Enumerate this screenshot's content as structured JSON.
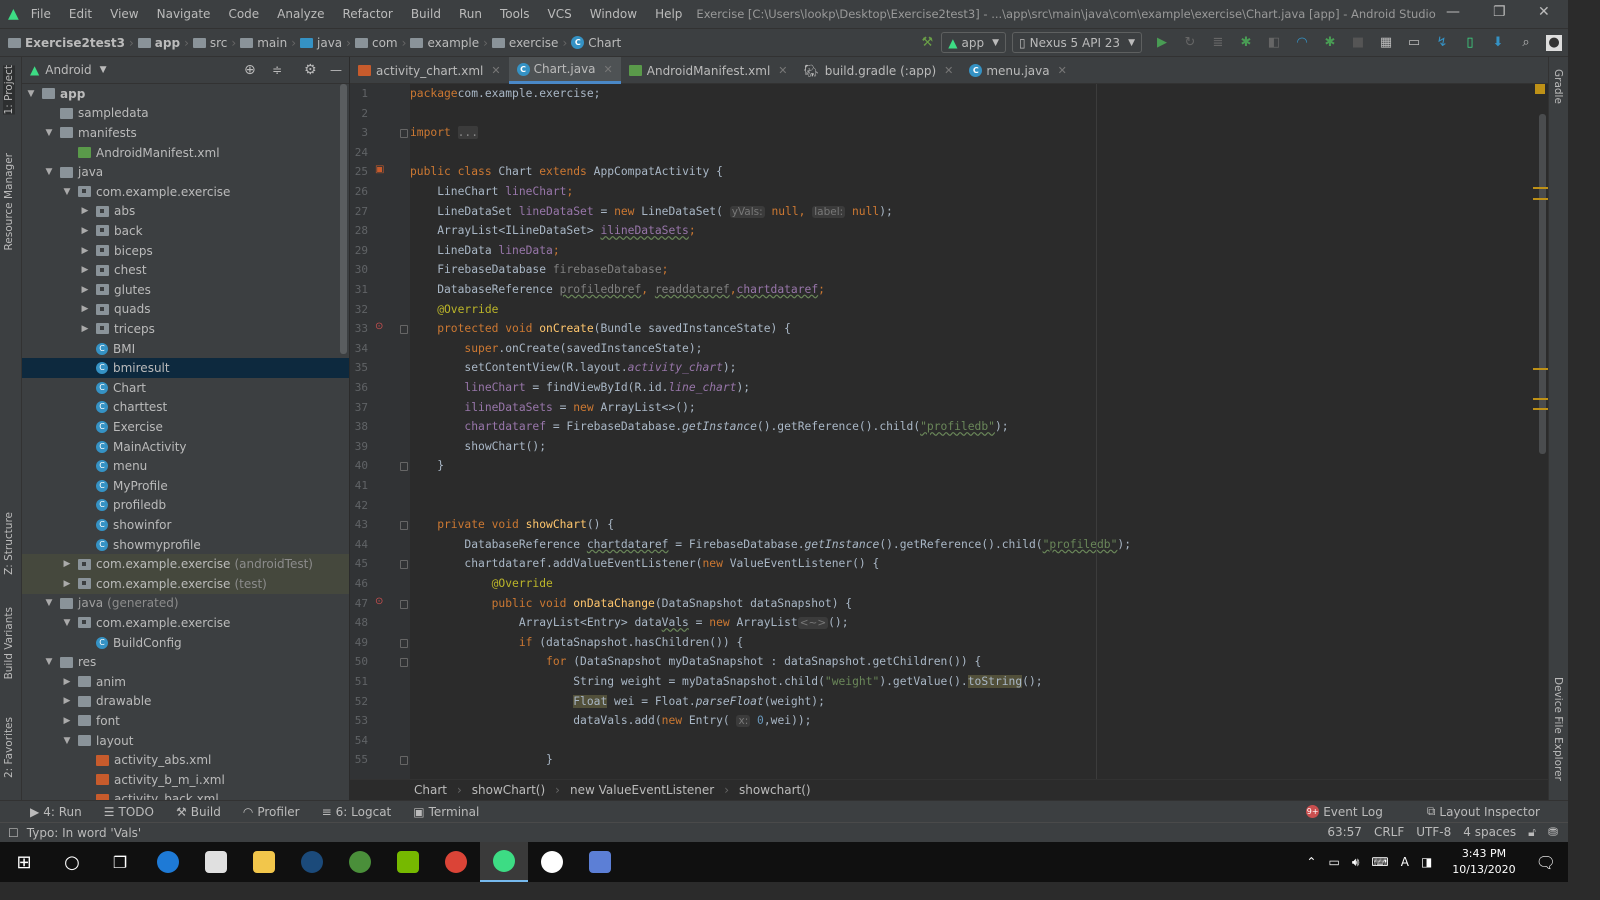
{
  "window": {
    "title": "Exercise [C:\\Users\\lookp\\Desktop\\Exercise2test3] - ...\\app\\src\\main\\java\\com\\example\\exercise\\Chart.java [app] - Android Studio",
    "menu": [
      "File",
      "Edit",
      "View",
      "Navigate",
      "Code",
      "Analyze",
      "Refactor",
      "Build",
      "Run",
      "Tools",
      "VCS",
      "Window",
      "Help"
    ]
  },
  "navbar": {
    "crumbs": [
      "Exercise2test3",
      "app",
      "src",
      "main",
      "java",
      "com",
      "example",
      "exercise",
      "Chart"
    ],
    "run_config": "app",
    "device": "Nexus 5 API 23"
  },
  "project": {
    "view_label": "Android",
    "tree": [
      {
        "label": "app",
        "level": 0,
        "arrow": "open",
        "icon": "folder",
        "bold": true
      },
      {
        "label": "sampledata",
        "level": 1,
        "arrow": "none",
        "icon": "folder"
      },
      {
        "label": "manifests",
        "level": 1,
        "arrow": "open",
        "icon": "folder"
      },
      {
        "label": "AndroidManifest.xml",
        "level": 2,
        "arrow": "none",
        "icon": "mf"
      },
      {
        "label": "java",
        "level": 1,
        "arrow": "open",
        "icon": "folder"
      },
      {
        "label": "com.example.exercise",
        "level": 2,
        "arrow": "open",
        "icon": "pkg"
      },
      {
        "label": "abs",
        "level": 3,
        "arrow": "closed",
        "icon": "pkg"
      },
      {
        "label": "back",
        "level": 3,
        "arrow": "closed",
        "icon": "pkg"
      },
      {
        "label": "biceps",
        "level": 3,
        "arrow": "closed",
        "icon": "pkg"
      },
      {
        "label": "chest",
        "level": 3,
        "arrow": "closed",
        "icon": "pkg"
      },
      {
        "label": "glutes",
        "level": 3,
        "arrow": "closed",
        "icon": "pkg"
      },
      {
        "label": "quads",
        "level": 3,
        "arrow": "closed",
        "icon": "pkg"
      },
      {
        "label": "triceps",
        "level": 3,
        "arrow": "closed",
        "icon": "pkg"
      },
      {
        "label": "BMI",
        "level": 3,
        "arrow": "none",
        "icon": "class"
      },
      {
        "label": "bmiresult",
        "level": 3,
        "arrow": "none",
        "icon": "class",
        "state": "selected"
      },
      {
        "label": "Chart",
        "level": 3,
        "arrow": "none",
        "icon": "class"
      },
      {
        "label": "charttest",
        "level": 3,
        "arrow": "none",
        "icon": "class"
      },
      {
        "label": "Exercise",
        "level": 3,
        "arrow": "none",
        "icon": "class"
      },
      {
        "label": "MainActivity",
        "level": 3,
        "arrow": "none",
        "icon": "class"
      },
      {
        "label": "menu",
        "level": 3,
        "arrow": "none",
        "icon": "class"
      },
      {
        "label": "MyProfile",
        "level": 3,
        "arrow": "none",
        "icon": "class"
      },
      {
        "label": "profiledb",
        "level": 3,
        "arrow": "none",
        "icon": "class"
      },
      {
        "label": "showinfor",
        "level": 3,
        "arrow": "none",
        "icon": "class"
      },
      {
        "label": "showmyprofile",
        "level": 3,
        "arrow": "none",
        "icon": "class"
      },
      {
        "label": "com.example.exercise",
        "suffix": "(androidTest)",
        "level": 2,
        "arrow": "closed",
        "icon": "pkg",
        "state": "highlight"
      },
      {
        "label": "com.example.exercise",
        "suffix": "(test)",
        "level": 2,
        "arrow": "closed",
        "icon": "pkg",
        "state": "highlight"
      },
      {
        "label": "java",
        "suffix": "(generated)",
        "level": 1,
        "arrow": "open",
        "icon": "folder",
        "muted": true
      },
      {
        "label": "com.example.exercise",
        "level": 2,
        "arrow": "open",
        "icon": "pkg"
      },
      {
        "label": "BuildConfig",
        "level": 3,
        "arrow": "none",
        "icon": "class"
      },
      {
        "label": "res",
        "level": 1,
        "arrow": "open",
        "icon": "res"
      },
      {
        "label": "anim",
        "level": 2,
        "arrow": "closed",
        "icon": "folder"
      },
      {
        "label": "drawable",
        "level": 2,
        "arrow": "closed",
        "icon": "folder"
      },
      {
        "label": "font",
        "level": 2,
        "arrow": "closed",
        "icon": "folder"
      },
      {
        "label": "layout",
        "level": 2,
        "arrow": "open",
        "icon": "folder"
      },
      {
        "label": "activity_abs.xml",
        "level": 3,
        "arrow": "none",
        "icon": "xml"
      },
      {
        "label": "activity_b_m_i.xml",
        "level": 3,
        "arrow": "none",
        "icon": "xml"
      },
      {
        "label": "activity_back.xml",
        "level": 3,
        "arrow": "none",
        "icon": "xml"
      }
    ]
  },
  "left_strip": [
    "1: Project",
    "Resource Manager",
    "Z: Structure",
    "Build Variants",
    "2: Favorites"
  ],
  "right_strip": [
    "Gradle",
    "Device File Explorer"
  ],
  "tabs": [
    {
      "label": "activity_chart.xml",
      "icon": "xml"
    },
    {
      "label": "Chart.java",
      "icon": "class",
      "active": true
    },
    {
      "label": "AndroidManifest.xml",
      "icon": "mf"
    },
    {
      "label": "build.gradle (:app)",
      "icon": "gradle"
    },
    {
      "label": "menu.java",
      "icon": "class"
    }
  ],
  "code": [
    {
      "n": 1,
      "t": [
        [
          "kw",
          "package"
        ],
        [
          "",
          "com.example.exercise;"
        ]
      ]
    },
    {
      "n": 2,
      "t": []
    },
    {
      "n": 3,
      "t": [
        [
          "kw",
          "import "
        ],
        [
          "fold",
          "..."
        ]
      ],
      "fold": true
    },
    {
      "n": 24,
      "t": []
    },
    {
      "n": 25,
      "t": [
        [
          "kw",
          "public class "
        ],
        [
          "",
          "Chart "
        ],
        [
          "kw",
          "extends "
        ],
        [
          "",
          "AppCompatActivity {"
        ]
      ],
      "icon": "xml"
    },
    {
      "n": 26,
      "t": [
        [
          "",
          "    LineChart "
        ],
        [
          "fld",
          "lineChart"
        ],
        [
          "kw",
          ";"
        ]
      ]
    },
    {
      "n": 27,
      "t": [
        [
          "",
          "    LineDataSet "
        ],
        [
          "fld",
          "lineDataSet"
        ],
        [
          "",
          " = "
        ],
        [
          "kw",
          "new "
        ],
        [
          "",
          "LineDataSet( "
        ],
        [
          "hint",
          "yVals:"
        ],
        [
          "kw",
          " null, "
        ],
        [
          "hint",
          "label:"
        ],
        [
          "kw",
          " null"
        ],
        [
          "",
          ");"
        ]
      ]
    },
    {
      "n": 28,
      "t": [
        [
          "",
          "    ArrayList<ILineDataSet> "
        ],
        [
          "fld ul",
          "ilineDataSets"
        ],
        [
          "kw",
          ";"
        ]
      ]
    },
    {
      "n": 29,
      "t": [
        [
          "",
          "    LineData "
        ],
        [
          "fld",
          "lineData"
        ],
        [
          "kw",
          ";"
        ]
      ]
    },
    {
      "n": 30,
      "t": [
        [
          "",
          "    FirebaseDatabase "
        ],
        [
          "gray",
          "firebaseDatabase"
        ],
        [
          "kw",
          ";"
        ]
      ]
    },
    {
      "n": 31,
      "t": [
        [
          "",
          "    DatabaseReference "
        ],
        [
          "gray ul",
          "profiledbref"
        ],
        [
          "kw",
          ", "
        ],
        [
          "gray ul",
          "readdataref"
        ],
        [
          "kw",
          ","
        ],
        [
          "fld ul",
          "chartdataref"
        ],
        [
          "kw",
          ";"
        ]
      ]
    },
    {
      "n": 32,
      "t": [
        [
          "ann",
          "    @Override"
        ]
      ]
    },
    {
      "n": 33,
      "t": [
        [
          "kw",
          "    protected void "
        ],
        [
          "fn",
          "onCreate"
        ],
        [
          "",
          "(Bundle savedInstanceState) {"
        ]
      ],
      "icon": "override",
      "fold": true
    },
    {
      "n": 34,
      "t": [
        [
          "kw",
          "        super"
        ],
        [
          "",
          ".onCreate(savedInstanceState);"
        ]
      ]
    },
    {
      "n": 35,
      "t": [
        [
          "",
          "        setContentView(R.layout."
        ],
        [
          "fld it",
          "activity_chart"
        ],
        [
          "",
          ");"
        ]
      ]
    },
    {
      "n": 36,
      "t": [
        [
          "fld",
          "        lineChart"
        ],
        [
          "",
          " = findViewById(R.id."
        ],
        [
          "fld it",
          "line_chart"
        ],
        [
          "",
          ");"
        ]
      ]
    },
    {
      "n": 37,
      "t": [
        [
          "fld",
          "        ilineDataSets"
        ],
        [
          "",
          " = "
        ],
        [
          "kw",
          "new "
        ],
        [
          "",
          "ArrayList<>();"
        ]
      ]
    },
    {
      "n": 38,
      "t": [
        [
          "fld",
          "        chartdataref"
        ],
        [
          "",
          " = FirebaseDatabase."
        ],
        [
          "it",
          "getInstance"
        ],
        [
          "",
          "().getReference().child("
        ],
        [
          "str ul",
          "\"profiledb\""
        ],
        [
          "",
          ");"
        ]
      ]
    },
    {
      "n": 39,
      "t": [
        [
          "",
          "        showChart();"
        ]
      ]
    },
    {
      "n": 40,
      "t": [
        [
          "",
          "    }"
        ]
      ],
      "fold": true
    },
    {
      "n": 41,
      "t": []
    },
    {
      "n": 42,
      "t": []
    },
    {
      "n": 43,
      "t": [
        [
          "kw",
          "    private void "
        ],
        [
          "fn",
          "showChart"
        ],
        [
          "",
          "() {"
        ]
      ],
      "fold": true
    },
    {
      "n": 44,
      "t": [
        [
          "",
          "        DatabaseReference "
        ],
        [
          "ul",
          "chartdataref"
        ],
        [
          "",
          " = FirebaseDatabase."
        ],
        [
          "it",
          "getInstance"
        ],
        [
          "",
          "().getReference().child("
        ],
        [
          "str ul",
          "\"profiledb\""
        ],
        [
          "",
          ");"
        ]
      ]
    },
    {
      "n": 45,
      "t": [
        [
          "",
          "        chartdataref.addValueEventListener("
        ],
        [
          "kw",
          "new "
        ],
        [
          "",
          "ValueEventListener() {"
        ]
      ],
      "fold": true
    },
    {
      "n": 46,
      "t": [
        [
          "ann",
          "            @Override"
        ]
      ]
    },
    {
      "n": 47,
      "t": [
        [
          "kw",
          "            public void "
        ],
        [
          "fn",
          "onDataChange"
        ],
        [
          "",
          "(DataSnapshot dataSnapshot) {"
        ]
      ],
      "icon": "override",
      "fold": true
    },
    {
      "n": 48,
      "t": [
        [
          "",
          "                ArrayList<Entry> data"
        ],
        [
          "ul",
          "Vals"
        ],
        [
          "",
          " = "
        ],
        [
          "kw",
          "new "
        ],
        [
          "",
          "ArrayList"
        ],
        [
          "hint",
          "<~>"
        ],
        [
          "",
          "();"
        ]
      ]
    },
    {
      "n": 49,
      "t": [
        [
          "kw",
          "                if "
        ],
        [
          "",
          "(dataSnapshot.hasChildren()) {"
        ]
      ],
      "fold": true
    },
    {
      "n": 50,
      "t": [
        [
          "kw",
          "                    for "
        ],
        [
          "",
          "(DataSnapshot myDataSnapshot : dataSnapshot.getChildren()) {"
        ]
      ],
      "fold": true
    },
    {
      "n": 51,
      "t": [
        [
          "",
          "                        String weight = myDataSnapshot.child("
        ],
        [
          "str",
          "\"weight\""
        ],
        [
          "",
          ").getValue()."
        ],
        [
          "hl",
          "toString"
        ],
        [
          "",
          "();"
        ]
      ]
    },
    {
      "n": 52,
      "t": [
        [
          "",
          "                        "
        ],
        [
          "hl",
          "Float"
        ],
        [
          "",
          " wei = Float."
        ],
        [
          "it",
          "parseFloat"
        ],
        [
          "",
          "(weight);"
        ]
      ]
    },
    {
      "n": 53,
      "t": [
        [
          "",
          "                        dataVals.add("
        ],
        [
          "kw",
          "new "
        ],
        [
          "",
          "Entry( "
        ],
        [
          "hint",
          "x:"
        ],
        [
          "num",
          " 0"
        ],
        [
          "",
          ",wei));"
        ]
      ]
    },
    {
      "n": 54,
      "t": []
    },
    {
      "n": 55,
      "t": [
        [
          "",
          "                    }"
        ]
      ],
      "fold": true
    }
  ],
  "editor_breadcrumb": [
    "Chart",
    "showChart()",
    "new ValueEventListener",
    "showchart()"
  ],
  "toolwindows": {
    "left": [
      {
        "label": "4: Run",
        "icon": "play-icon",
        "g": "▶"
      },
      {
        "label": "TODO",
        "icon": "list-icon",
        "g": "☰"
      },
      {
        "label": "Build",
        "icon": "hammer-icon",
        "g": "⚒"
      },
      {
        "label": "Profiler",
        "icon": "gauge-icon",
        "g": "◠"
      },
      {
        "label": "6: Logcat",
        "icon": "logcat-icon",
        "g": "≡"
      },
      {
        "label": "Terminal",
        "icon": "terminal-icon",
        "g": "▣"
      }
    ],
    "right": [
      {
        "label": "Event Log",
        "badge": "9+"
      },
      {
        "label": "Layout Inspector"
      }
    ]
  },
  "status": {
    "message": "Typo: In word 'Vals'",
    "position": "63:57",
    "line_sep": "CRLF",
    "encoding": "UTF-8",
    "indent": "4 spaces"
  },
  "taskbar": {
    "time": "3:43 PM",
    "date": "10/13/2020",
    "apps": [
      {
        "name": "edge",
        "color": "#1e7ad6"
      },
      {
        "name": "store",
        "color": "#e0e0e0"
      },
      {
        "name": "file-explorer",
        "color": "#f2c64b"
      },
      {
        "name": "steam",
        "color": "#1b4a7a"
      },
      {
        "name": "app-green",
        "color": "#4a8f3a"
      },
      {
        "name": "nvidia",
        "color": "#76b900"
      },
      {
        "name": "chrome",
        "color": "#db4437"
      },
      {
        "name": "android-studio",
        "color": "#3ddc84",
        "active": true
      },
      {
        "name": "app-sync",
        "color": "#ffffff"
      },
      {
        "name": "app-window",
        "color": "#5c7fd6"
      }
    ]
  },
  "colors": {
    "accent": "#4a88c7",
    "selection": "#0d293e",
    "keyword": "#cc7832",
    "string": "#6a8759"
  }
}
